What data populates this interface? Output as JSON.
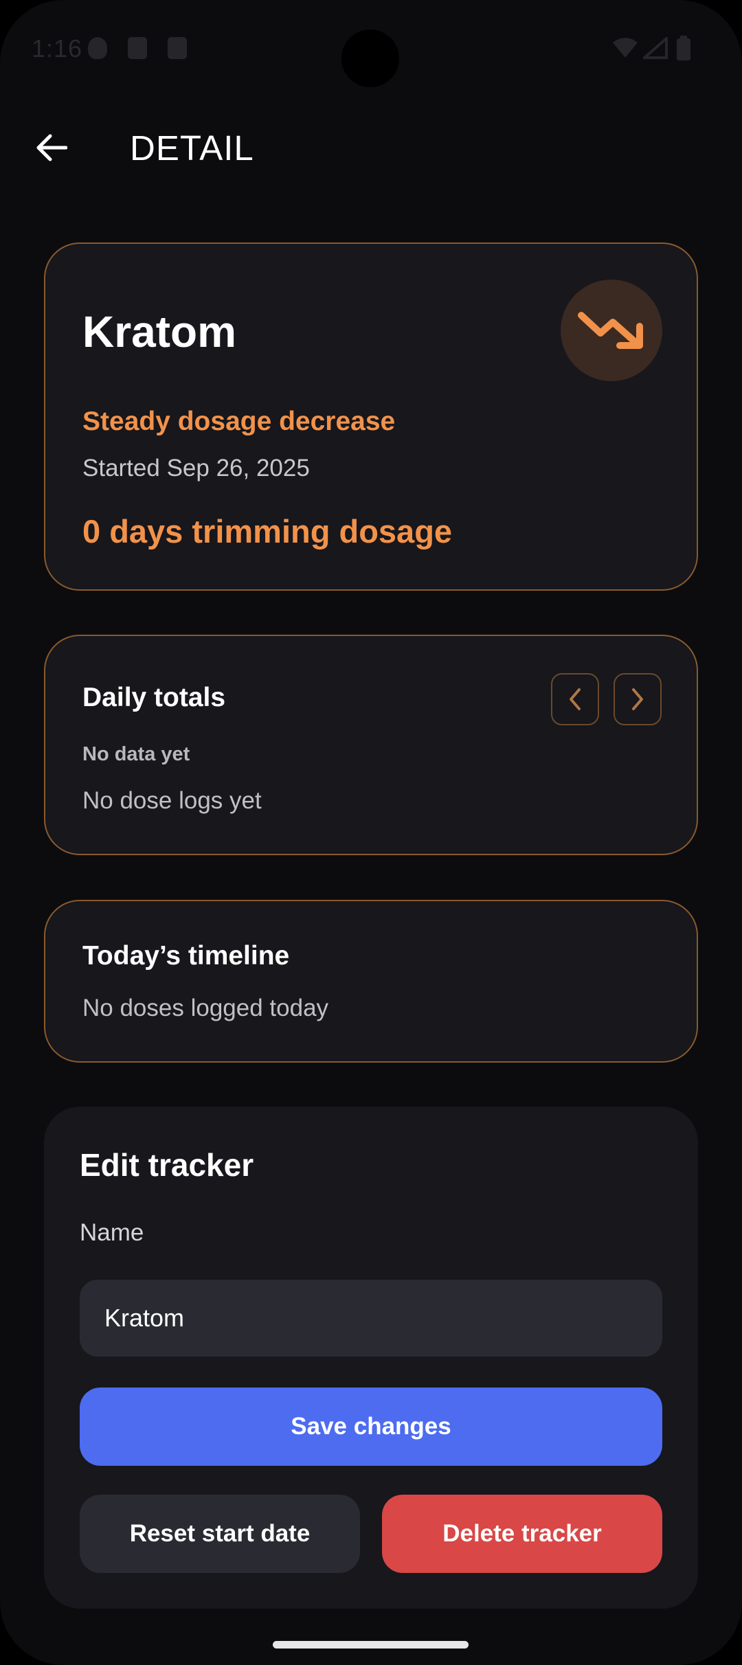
{
  "status_bar": {
    "time": "1:16"
  },
  "header": {
    "title": "DETAIL",
    "back_icon": "arrow-left-icon"
  },
  "summary": {
    "name": "Kratom",
    "trend_icon": "trending-down-icon",
    "plan": "Steady dosage decrease",
    "started": "Started Sep 26, 2025",
    "progress": "0 days trimming dosage"
  },
  "daily_totals": {
    "title": "Daily totals",
    "subtitle": "No data yet",
    "empty_text": "No dose logs yet",
    "prev_icon": "chevron-left-icon",
    "next_icon": "chevron-right-icon"
  },
  "timeline": {
    "title": "Today’s timeline",
    "empty_text": "No doses logged today"
  },
  "edit": {
    "title": "Edit tracker",
    "name_label": "Name",
    "name_value": "Kratom",
    "save_label": "Save changes",
    "reset_label": "Reset start date",
    "delete_label": "Delete tracker"
  },
  "colors": {
    "accent": "#f2924a",
    "card_border": "#8a5a2e",
    "primary_button": "#4d6cf0",
    "danger_button": "#d94747",
    "background": "#0c0c0f"
  }
}
